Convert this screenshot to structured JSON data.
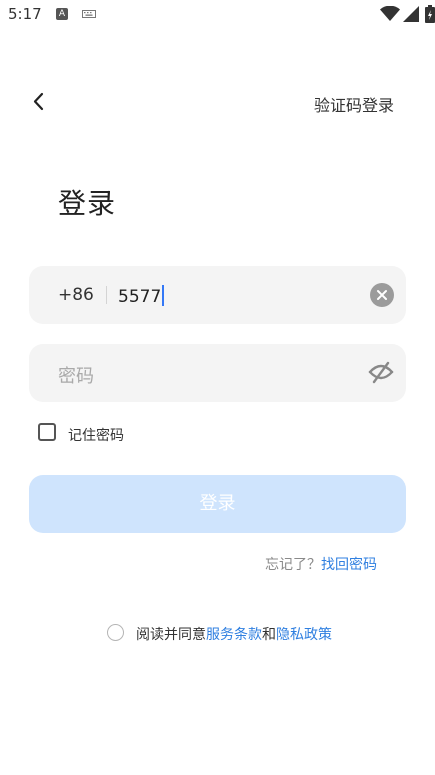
{
  "status_bar": {
    "time": "5:17",
    "a_icon": "A",
    "icons": [
      "keyboard-icon",
      "wifi-icon",
      "signal-icon",
      "battery-icon"
    ]
  },
  "header": {
    "back_icon": "chevron-left-icon",
    "switch_mode_label": "验证码登录"
  },
  "title": "登录",
  "phone_field": {
    "country_code": "+86",
    "value": "5577",
    "clear_icon": "clear-icon"
  },
  "password_field": {
    "placeholder": "密码",
    "toggle_icon": "eye-off-icon"
  },
  "remember": {
    "label": "记住密码",
    "checked": false
  },
  "login_button": {
    "label": "登录",
    "enabled": false
  },
  "forgot": {
    "prefix": "忘记了？",
    "link": "找回密码"
  },
  "agreement": {
    "checked": false,
    "prefix": "阅读并同意",
    "terms_link": "服务条款",
    "conjunction": "和",
    "privacy_link": "隐私政策"
  },
  "colors": {
    "accent": "#2f7fe0",
    "field_bg": "#f4f4f4",
    "disabled_button": "#cfe4fd",
    "caret": "#3478f6"
  }
}
